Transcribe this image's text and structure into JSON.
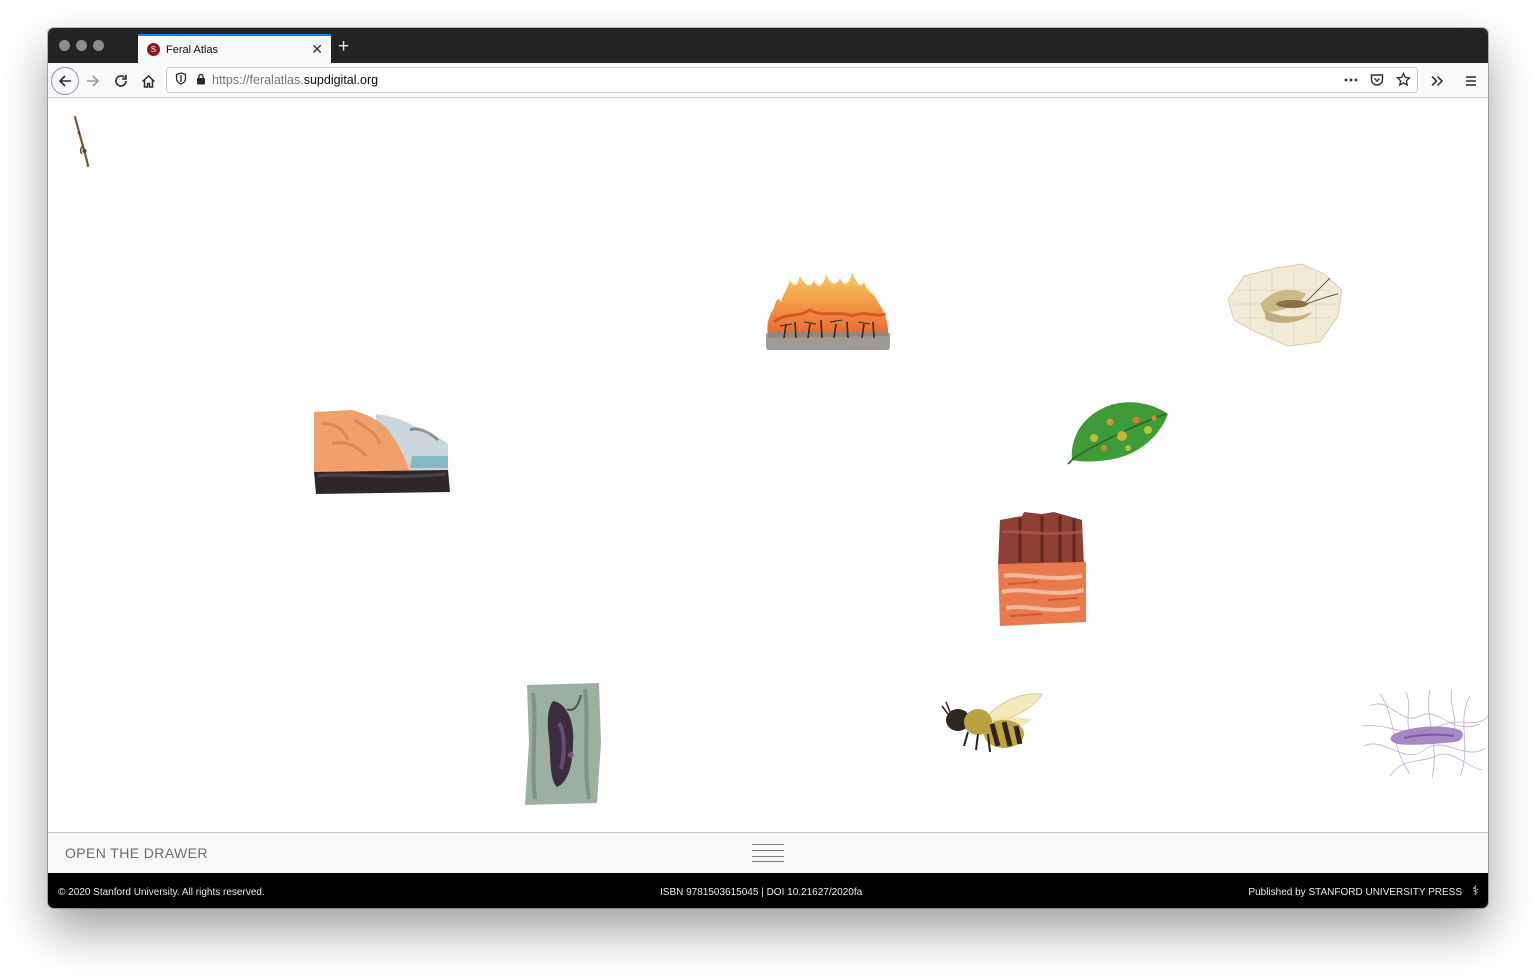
{
  "browser": {
    "tab_title": "Feral Atlas",
    "favicon_letter": "S",
    "url_prefix": "https://feralatlas.",
    "url_domain": "supdigital.org",
    "icons": [
      "back-arrow-icon",
      "forward-arrow-icon",
      "reload-icon",
      "home-icon",
      "shield-icon",
      "lock-icon",
      "more-actions-icon",
      "pocket-icon",
      "bookmark-star-icon",
      "overflow-chevrons-icon",
      "hamburger-menu-icon"
    ]
  },
  "artworks": [
    {
      "name": "twig-illustration"
    },
    {
      "name": "wildfire-illustration"
    },
    {
      "name": "moth-illustration"
    },
    {
      "name": "coastal-cliff-illustration"
    },
    {
      "name": "spotted-leaf-illustration"
    },
    {
      "name": "red-rock-mesa-illustration"
    },
    {
      "name": "tree-bark-illustration"
    },
    {
      "name": "honeybee-illustration"
    },
    {
      "name": "bacterium-illustration"
    }
  ],
  "drawer": {
    "label": "OPEN THE DRAWER"
  },
  "footer": {
    "copyright": "© 2020 Stanford University. All rights reserved.",
    "isbn": "ISBN 9781503615045 | DOI 10.21627/2020fa",
    "publisher": "Published by STANFORD UNIVERSITY PRESS"
  },
  "colors": {
    "tabstrip": "#232323",
    "active_tab_line": "#0a84ff",
    "footer_bg": "#000000",
    "drawer_bg": "#f8f8f8"
  }
}
